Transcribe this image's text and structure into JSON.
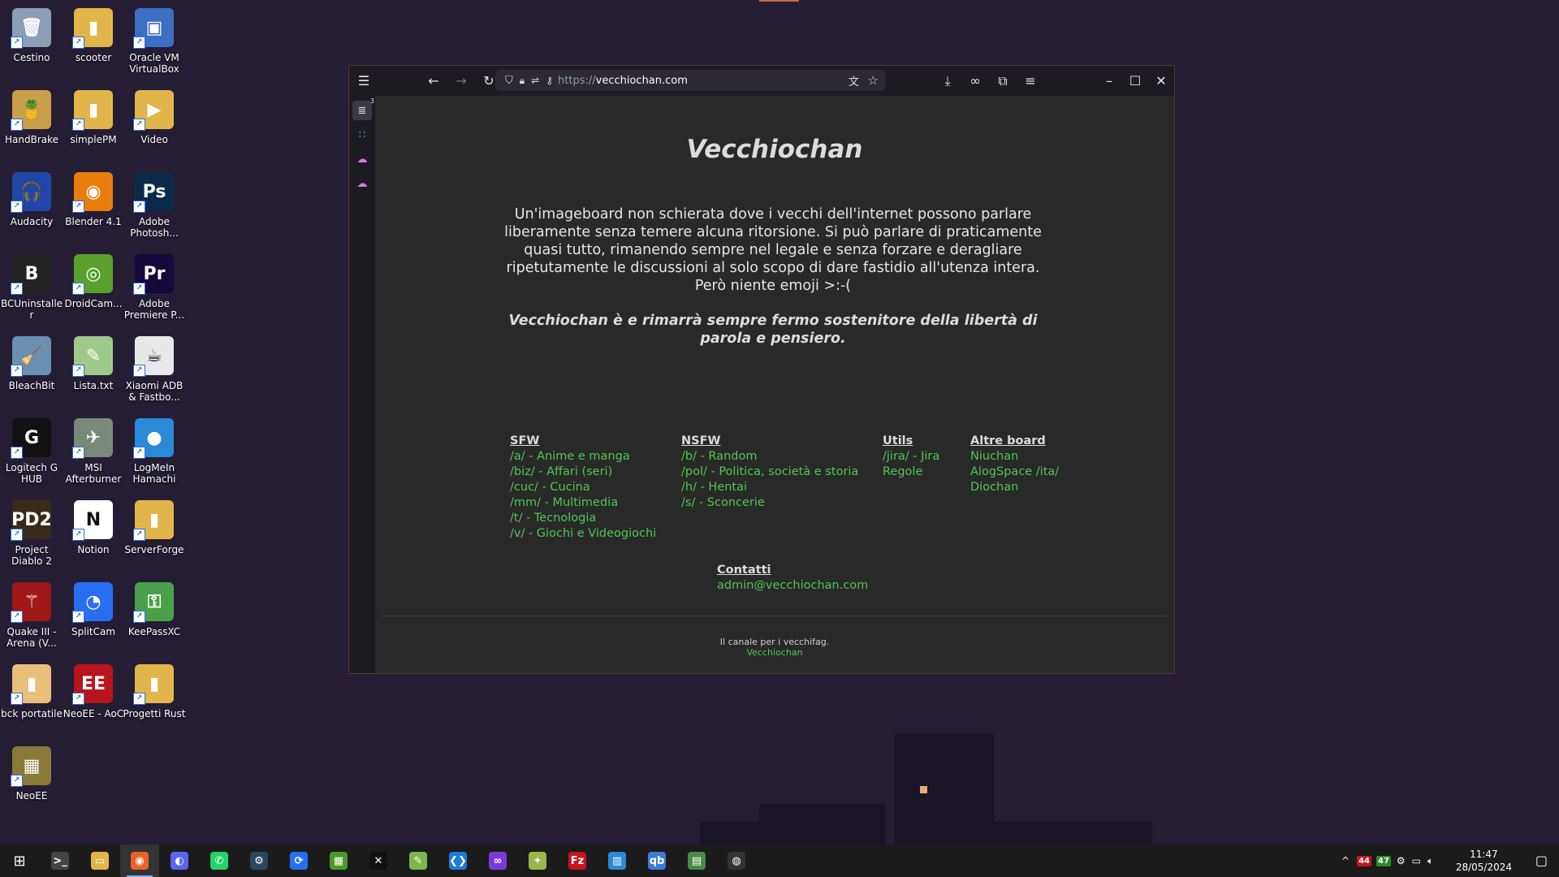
{
  "desktop": {
    "icons": [
      {
        "label": "Cestino",
        "glyph": "🗑",
        "color": "#8aa0b8"
      },
      {
        "label": "scooter",
        "glyph": "▮",
        "color": "#e2b54a"
      },
      {
        "label": "Oracle VM VirtualBox",
        "glyph": "▣",
        "color": "#3b6fc4"
      },
      {
        "label": "HandBrake",
        "glyph": "🍍",
        "color": "#c8a04a"
      },
      {
        "label": "simplePM",
        "glyph": "▮",
        "color": "#e2b54a"
      },
      {
        "label": "Video",
        "glyph": "▶",
        "color": "#e2b54a"
      },
      {
        "label": "Audacity",
        "glyph": "🎧",
        "color": "#2146a8"
      },
      {
        "label": "Blender 4.1",
        "glyph": "◉",
        "color": "#e87d0d"
      },
      {
        "label": "Adobe Photosh...",
        "glyph": "Ps",
        "color": "#0b2a4a"
      },
      {
        "label": "BCUninstaller",
        "glyph": "B",
        "color": "#222"
      },
      {
        "label": "DroidCam...",
        "glyph": "◎",
        "color": "#5aa02c"
      },
      {
        "label": "Adobe Premiere P...",
        "glyph": "Pr",
        "color": "#15083a"
      },
      {
        "label": "BleachBit",
        "glyph": "🧹",
        "color": "#6b8fb0"
      },
      {
        "label": "Lista.txt",
        "glyph": "✎",
        "color": "#9fc98a"
      },
      {
        "label": "Xiaomi ADB & Fastbo...",
        "glyph": "☕",
        "color": "#e8e8e8"
      },
      {
        "label": "Logitech G HUB",
        "glyph": "G",
        "color": "#111"
      },
      {
        "label": "MSI Afterburner",
        "glyph": "✈",
        "color": "#7a8a7a"
      },
      {
        "label": "LogMeIn Hamachi",
        "glyph": "●",
        "color": "#2a8ad8"
      },
      {
        "label": "Project Diablo 2",
        "glyph": "PD2",
        "color": "#3a2a1a"
      },
      {
        "label": "Notion",
        "glyph": "N",
        "color": "#fff"
      },
      {
        "label": "ServerForge",
        "glyph": "▮",
        "color": "#e2b54a"
      },
      {
        "label": "Quake III - Arena (V...",
        "glyph": "⚚",
        "color": "#a01818"
      },
      {
        "label": "SplitCam",
        "glyph": "◔",
        "color": "#2a6ef0"
      },
      {
        "label": "KeePassXC",
        "glyph": "⚿",
        "color": "#4aa04a"
      },
      {
        "label": "bck portatile",
        "glyph": "▮",
        "color": "#e8c07a"
      },
      {
        "label": "NeoEE - AoC",
        "glyph": "EE",
        "color": "#b8141e"
      },
      {
        "label": "Progetti Rust",
        "glyph": "▮",
        "color": "#e2b54a"
      },
      {
        "label": "NeoEE",
        "glyph": "▦",
        "color": "#8a7a3a"
      }
    ]
  },
  "browser": {
    "url_scheme": "https://",
    "url_host": "vecchiochan.com",
    "sidebar_badge": "3"
  },
  "page": {
    "title": "Vecchiochan",
    "intro": "Un'imageboard non schierata dove i vecchi dell'internet possono parlare liberamente senza temere alcuna ritorsione. Si può parlare di praticamente quasi tutto, rimanendo sempre nel legale e senza forzare e deragliare ripetutamente le discussioni al solo scopo di dare fastidio all'utenza intera. Però niente emoji >:-(",
    "motto": "Vecchiochan è e rimarrà sempre fermo sostenitore della libertà di parola e pensiero.",
    "columns": [
      {
        "heading": "SFW",
        "links": [
          "/a/ - Anime e manga",
          "/biz/ - Affari (seri)",
          "/cuc/ - Cucina",
          "/mm/ - Multimedia",
          "/t/ - Tecnologia",
          "/v/ - Giochi e Videogiochi"
        ]
      },
      {
        "heading": "NSFW",
        "links": [
          "/b/ - Random",
          "/pol/ - Politica, società e storia",
          "/h/ - Hentai",
          "/s/ - Sconcerie"
        ]
      },
      {
        "heading": "Utils",
        "links": [
          "/jira/ - Jira",
          "Regole"
        ]
      },
      {
        "heading": "Altre board",
        "links": [
          "Niuchan",
          "AlogSpace /ita/",
          "Diochan"
        ]
      }
    ],
    "contact": {
      "heading": "Contatti",
      "email": "admin@vecchiochan.com"
    },
    "footer": {
      "text": "Il canale per i vecchifag.",
      "link": "Vecchiochan"
    }
  },
  "taskbar": {
    "apps": [
      {
        "name": "terminal",
        "glyph": ">_",
        "color": "#444"
      },
      {
        "name": "file-explorer",
        "glyph": "▭",
        "color": "#e2b54a"
      },
      {
        "name": "firefox",
        "glyph": "◉",
        "color": "#e8622a",
        "active": true
      },
      {
        "name": "discord",
        "glyph": "◐",
        "color": "#5865f2"
      },
      {
        "name": "whatsapp",
        "glyph": "✆",
        "color": "#25d366"
      },
      {
        "name": "steam",
        "glyph": "⚙",
        "color": "#2a475e"
      },
      {
        "name": "edge-dev",
        "glyph": "⟳",
        "color": "#2a6ef0"
      },
      {
        "name": "minecraft",
        "glyph": "▦",
        "color": "#4a9a2a"
      },
      {
        "name": "capcut",
        "glyph": "✕",
        "color": "#111"
      },
      {
        "name": "notepad-plus",
        "glyph": "✎",
        "color": "#7ab84a"
      },
      {
        "name": "vscode",
        "glyph": "❮❯",
        "color": "#1e7ad8"
      },
      {
        "name": "visual-studio",
        "glyph": "∞",
        "color": "#7a3ad8"
      },
      {
        "name": "cheat-engine",
        "glyph": "✦",
        "color": "#9ab84a"
      },
      {
        "name": "filezilla",
        "glyph": "Fz",
        "color": "#c8141e"
      },
      {
        "name": "task-manager",
        "glyph": "▥",
        "color": "#2a8ad8"
      },
      {
        "name": "qbittorrent",
        "glyph": "qb",
        "color": "#3a7ad8"
      },
      {
        "name": "gpu-tool",
        "glyph": "▤",
        "color": "#4a8a4a"
      },
      {
        "name": "obs",
        "glyph": "◍",
        "color": "#333"
      }
    ],
    "tray_badges": [
      "44",
      "47"
    ],
    "time": "11:47",
    "date": "28/05/2024"
  }
}
